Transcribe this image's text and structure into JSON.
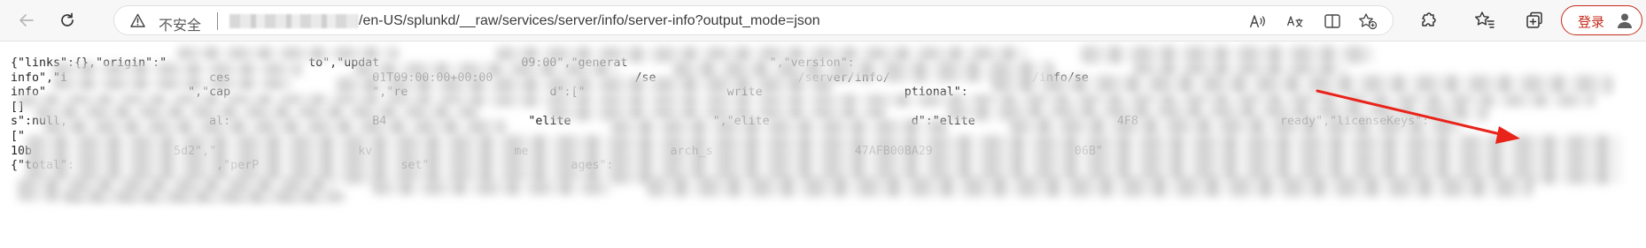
{
  "toolbar": {
    "security_label": "不安全",
    "url_visible_path": "/en-US/splunkd/__raw/services/server/info/server-info?output_mode=json",
    "login_label": "登录"
  },
  "icons": {
    "back": "back-arrow-icon",
    "refresh": "refresh-icon",
    "warning": "warning-icon",
    "read_aloud": "read-aloud-icon",
    "translate": "translate-icon",
    "reader": "reader-view-icon",
    "favorite_add": "add-favorite-icon",
    "extensions": "extensions-icon",
    "favorites": "favorites-icon",
    "collections": "collections-icon",
    "profile": "profile-icon"
  },
  "page": {
    "visible_fragments": [
      "{\"links\":{},\"origin\":\"",
      "to\",\"updat",
      "09:00\",\"generat",
      "\",\"version\":",
      "info\",\"i",
      "ces",
      "01T09:00:00+00:00",
      "/se",
      "/server/info/",
      "/info/se",
      "info\"",
      "\",\"cap",
      "\",\"re",
      "d\":[\"",
      "write",
      "ptional\":",
      "[]",
      "s\":null,",
      "al:",
      "B4",
      "\"elite",
      "\",\"elite",
      "d\":\"elite",
      "4F8",
      "ready\",\"licenseKeys\":",
      "[\"",
      "10b",
      "5d2\",\"",
      "kv",
      "me",
      "arch_s",
      "47AFB00BA29",
      "06B\"",
      "{\"total\":",
      ",\"perP",
      "set\"",
      "ages\":"
    ]
  },
  "annotation": {
    "color": "#e8231a"
  }
}
